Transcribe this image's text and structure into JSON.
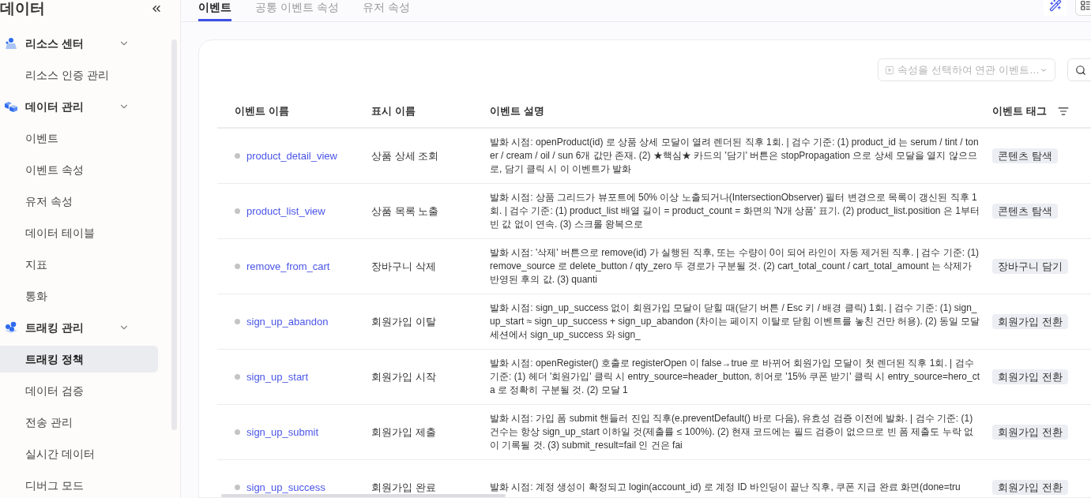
{
  "sidebar": {
    "title": "데이터",
    "groups": [
      {
        "kind": "person",
        "label": "리소스 센터",
        "expanded": true,
        "items": [
          {
            "label": "리소스 인증 관리",
            "selected": false
          }
        ]
      },
      {
        "kind": "cubes",
        "label": "데이터 관리",
        "expanded": true,
        "items": [
          {
            "label": "이벤트",
            "selected": false
          },
          {
            "label": "이벤트 속성",
            "selected": false
          },
          {
            "label": "유저 속성",
            "selected": false
          },
          {
            "label": "데이터 테이블",
            "selected": false
          },
          {
            "label": "지표",
            "selected": false
          },
          {
            "label": "통화",
            "selected": false
          }
        ]
      },
      {
        "kind": "dots",
        "label": "트래킹 관리",
        "expanded": true,
        "items": [
          {
            "label": "트래킹 정책",
            "selected": true
          },
          {
            "label": "데이터 검증",
            "selected": false
          },
          {
            "label": "전송 관리",
            "selected": false
          },
          {
            "label": "실시간 데이터",
            "selected": false
          },
          {
            "label": "디버그 모드",
            "selected": false
          }
        ]
      }
    ]
  },
  "tabs": [
    {
      "label": "이벤트",
      "selected": true
    },
    {
      "label": "공통 이벤트 속성",
      "selected": false
    },
    {
      "label": "유저 속성",
      "selected": false
    }
  ],
  "filter": {
    "placeholder": "속성을 선택하여 연관 이벤트…"
  },
  "table": {
    "columns": [
      "이벤트 이름",
      "표시 이름",
      "이벤트 설명",
      "이벤트 태그"
    ],
    "rows": [
      {
        "name": "product_detail_view",
        "display": "상품 상세 조회",
        "description": "발화 시점: openProduct(id) 로 상품 상세 모달이 열려 렌더된 직후 1회. | 검수 기준: (1) product_id 는 serum / tint / toner / cream / oil / sun 6개 값만 존재. (2) ★핵심★ 카드의 '담기' 버튼은 stopPropagation 으로 상세 모달을 열지 않으므로, 담기 클릭 시 이 이벤트가 발화",
        "tag": "콘텐츠 탐색"
      },
      {
        "name": "product_list_view",
        "display": "상품 목록 노출",
        "description": "발화 시점: 상품 그리드가 뷰포트에 50% 이상 노출되거나(IntersectionObserver) 필터 변경으로 목록이 갱신된 직후 1회. | 검수 기준: (1) product_list 배열 길이 = product_count = 화면의 'N개 상품' 표기. (2) product_list.position 은 1부터 빈 값 없이 연속. (3) 스크롤 왕복으로",
        "tag": "콘텐츠 탐색"
      },
      {
        "name": "remove_from_cart",
        "display": "장바구니 삭제",
        "description": "발화 시점: '삭제' 버튼으로 remove(id) 가 실행된 직후, 또는 수량이 0이 되어 라인이 자동 제거된 직후. | 검수 기준: (1) remove_source 로 delete_button / qty_zero 두 경로가 구분될 것. (2) cart_total_count / cart_total_amount 는 삭제가 반영된 후의 값. (3) quanti",
        "tag": "장바구니 담기"
      },
      {
        "name": "sign_up_abandon",
        "display": "회원가입 이탈",
        "description": "발화 시점: sign_up_success 없이 회원가입 모달이 닫힐 때(닫기 버튼 / Esc 키 / 배경 클릭) 1회. | 검수 기준: (1) sign_up_start ≈ sign_up_success + sign_up_abandon (차이는 페이지 이탈로 닫힘 이벤트를 놓친 건만 허용). (2) 동일 모달 세션에서 sign_up_success 와 sign_",
        "tag": "회원가입 전환"
      },
      {
        "name": "sign_up_start",
        "display": "회원가입 시작",
        "description": "발화 시점: openRegister() 호출로 registerOpen 이 false→true 로 바뀌어 회원가입 모달이 첫 렌더된 직후 1회. | 검수 기준: (1) 헤더 '회원가입' 클릭 시 entry_source=header_button, 히어로 '15% 쿠폰 받기' 클릭 시 entry_source=hero_cta 로 정확히 구분될 것. (2) 모달 1",
        "tag": "회원가입 전환"
      },
      {
        "name": "sign_up_submit",
        "display": "회원가입 제출",
        "description": "발화 시점: 가입 폼 submit 핸들러 진입 직후(e.preventDefault() 바로 다음), 유효성 검증 이전에 발화. | 검수 기준: (1) 건수는 항상 sign_up_start 이하일 것(제출률 ≤ 100%). (2) 현재 코드에는 필드 검증이 없으므로 빈 폼 제출도 누락 없이 기록될 것. (3) submit_result=fail 인 건은 fai",
        "tag": "회원가입 전환"
      },
      {
        "name": "sign_up_success",
        "display": "회원가입 완료",
        "description": "발화 시점: 계정 생성이 확정되고 login(account_id) 로 계정 ID 바인딩이 끝난 직후, 쿠폰 지급 완료 화면(done=tru",
        "tag": "회원가입 전환"
      }
    ]
  }
}
